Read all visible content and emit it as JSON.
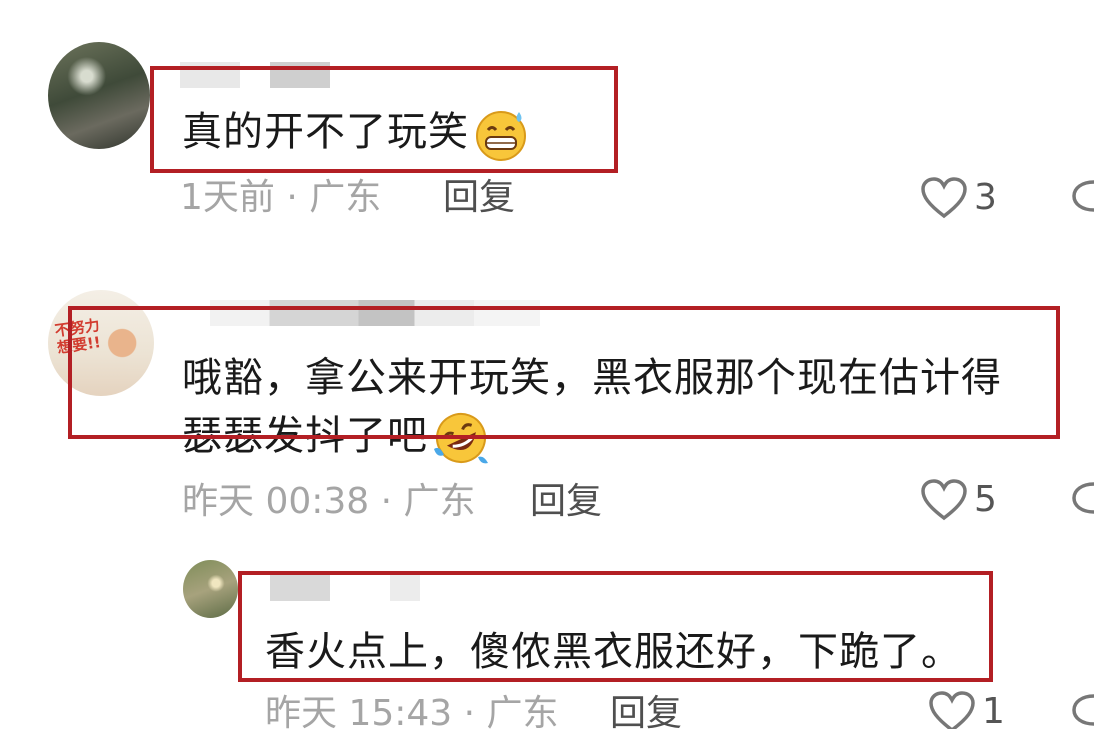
{
  "comments": [
    {
      "text": "真的开不了玩笑",
      "emoji": "grinning-sweat-emoji",
      "meta": "1天前 · 广东",
      "reply_label": "回复",
      "likes": "3"
    },
    {
      "text_line1": "哦豁，拿公来开玩笑，黑衣服那个现在估计得",
      "text_line2": "瑟瑟发抖了吧",
      "emoji": "rolling-laughing-emoji",
      "meta": "昨天 00:38 · 广东",
      "reply_label": "回复",
      "likes": "5",
      "avatar_text": "不努力\n想要!!"
    },
    {
      "text": "香火点上，傻侬黑衣服还好，下跪了。",
      "meta": "昨天 15:43 · 广东",
      "reply_label": "回复",
      "likes": "1"
    }
  ],
  "colors": {
    "highlight": "#b31f24",
    "meta_gray": "#a5a5a5",
    "text": "#1a1a1a"
  },
  "icons": [
    "heart-outline-icon",
    "comment-bubble-icon"
  ]
}
